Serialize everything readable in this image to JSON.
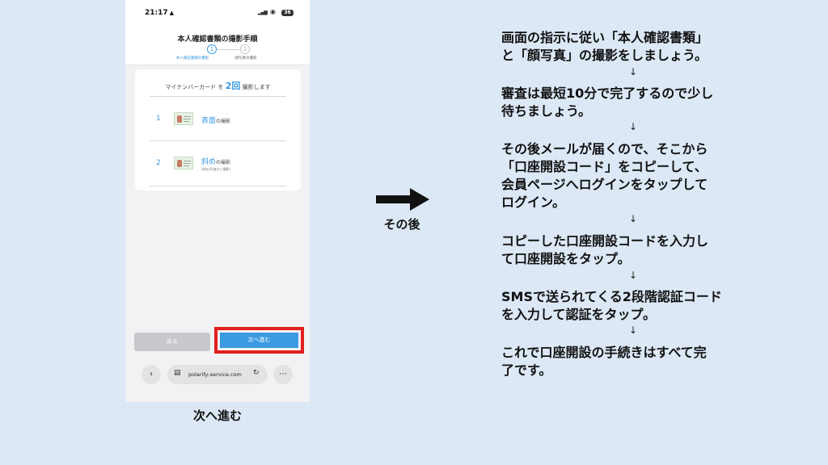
{
  "phone": {
    "status": {
      "time": "21:17",
      "battery": "36"
    },
    "header": {
      "title": "本人確認書類の撮影手順",
      "steps": [
        {
          "num": "1",
          "label": "本人確認書類の撮影"
        },
        {
          "num": "2",
          "label": "顔写真の撮影"
        }
      ]
    },
    "card": {
      "title_pre": "マイナンバーカード を",
      "title_num": "2",
      "title_unit": "回",
      "title_post": "撮影します",
      "items": [
        {
          "num": "1",
          "highlight": "表面",
          "label": "の撮影",
          "sub": ""
        },
        {
          "num": "2",
          "highlight": "斜め",
          "label": "の撮影",
          "sub": "(斜め45度から撮影)"
        }
      ]
    },
    "buttons": {
      "back": "戻る",
      "next": "次へ進む"
    },
    "browser": {
      "url": "polarify-service.com"
    },
    "highlight_color": "#e41e1e",
    "accent_color": "#3b9ae1"
  },
  "phone_caption": "次へ進む",
  "arrow_caption": "その後",
  "instructions": {
    "s1": [
      "画面の指示に従い「本人確認書類」",
      "と「顔写真」の撮影をしましょう。"
    ],
    "s2": [
      "審査は最短10分で完了するので少し",
      "待ちましょう。"
    ],
    "s3": [
      "その後メールが届くので、そこから",
      "「口座開設コード」をコピーして、",
      "会員ページへログインをタップして",
      "ログイン。"
    ],
    "s4": [
      "コピーした口座開設コードを入力し",
      "て口座開設をタップ。"
    ],
    "s5": [
      "SMSで送られてくる2段階認証コード",
      "を入力して認証をタップ。"
    ],
    "s6": [
      "これで口座開設の手続きはすべて完",
      "了です。"
    ]
  }
}
